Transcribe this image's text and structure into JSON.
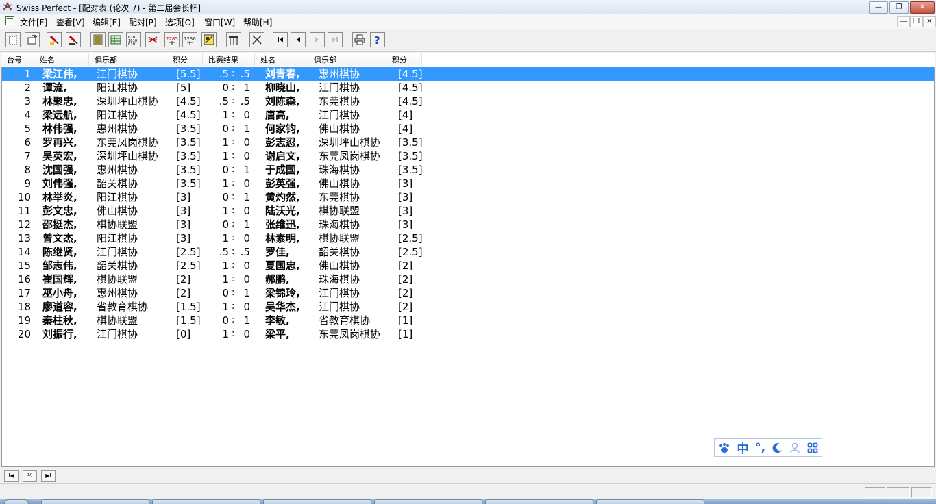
{
  "window": {
    "title": "Swiss Perfect - [配对表  (轮次 7) - 第二届会长杯]",
    "minimize_glyph": "—",
    "restore_glyph": "❐",
    "close_glyph": "✕"
  },
  "menu": {
    "items": [
      "文件[F]",
      "查看[V]",
      "编辑[E]",
      "配对[P]",
      "选项[O]",
      "窗口[W]",
      "帮助[H]"
    ],
    "mdi_minimize": "—",
    "mdi_restore": "❐",
    "mdi_close": "✕"
  },
  "toolbar": {
    "label_2285": "2285",
    "label_1236": "1236"
  },
  "table": {
    "headers": [
      "台号",
      "姓名",
      "俱乐部",
      "积分",
      "比赛结果",
      "姓名",
      "俱乐部",
      "积分"
    ],
    "colon": ":",
    "rows": [
      {
        "board": "1",
        "white": "梁江伟,",
        "club1": "江门棋协",
        "pts1": "[5.5]",
        "s1": ".5",
        "s2": ".5",
        "black": "刘青春,",
        "club2": "惠州棋协",
        "pts2": "[4.5]"
      },
      {
        "board": "2",
        "white": "谭流,",
        "club1": "阳江棋协",
        "pts1": "[5]",
        "s1": "0",
        "s2": "1",
        "black": "柳晓山,",
        "club2": "江门棋协",
        "pts2": "[4.5]"
      },
      {
        "board": "3",
        "white": "林聚忠,",
        "club1": "深圳坪山棋协",
        "pts1": "[4.5]",
        "s1": ".5",
        "s2": ".5",
        "black": "刘陈森,",
        "club2": "东莞棋协",
        "pts2": "[4.5]"
      },
      {
        "board": "4",
        "white": "梁远航,",
        "club1": "阳江棋协",
        "pts1": "[4.5]",
        "s1": "1",
        "s2": "0",
        "black": "唐高,",
        "club2": "江门棋协",
        "pts2": "[4]"
      },
      {
        "board": "5",
        "white": "林伟强,",
        "club1": "惠州棋协",
        "pts1": "[3.5]",
        "s1": "0",
        "s2": "1",
        "black": "何家钧,",
        "club2": "佛山棋协",
        "pts2": "[4]"
      },
      {
        "board": "6",
        "white": "罗再兴,",
        "club1": "东莞凤岗棋协",
        "pts1": "[3.5]",
        "s1": "1",
        "s2": "0",
        "black": "彭志忍,",
        "club2": "深圳坪山棋协",
        "pts2": "[3.5]"
      },
      {
        "board": "7",
        "white": "吴英宏,",
        "club1": "深圳坪山棋协",
        "pts1": "[3.5]",
        "s1": "1",
        "s2": "0",
        "black": "谢启文,",
        "club2": "东莞凤岗棋协",
        "pts2": "[3.5]"
      },
      {
        "board": "8",
        "white": "沈国强,",
        "club1": "惠州棋协",
        "pts1": "[3.5]",
        "s1": "0",
        "s2": "1",
        "black": "于成国,",
        "club2": "珠海棋协",
        "pts2": "[3.5]"
      },
      {
        "board": "9",
        "white": "刘伟强,",
        "club1": "韶关棋协",
        "pts1": "[3.5]",
        "s1": "1",
        "s2": "0",
        "black": "彭英强,",
        "club2": "佛山棋协",
        "pts2": "[3]"
      },
      {
        "board": "10",
        "white": "林举炎,",
        "club1": "阳江棋协",
        "pts1": "[3]",
        "s1": "0",
        "s2": "1",
        "black": "黄灼然,",
        "club2": "东莞棋协",
        "pts2": "[3]"
      },
      {
        "board": "11",
        "white": "彭文忠,",
        "club1": "佛山棋协",
        "pts1": "[3]",
        "s1": "1",
        "s2": "0",
        "black": "陆沃光,",
        "club2": "棋协联盟",
        "pts2": "[3]"
      },
      {
        "board": "12",
        "white": "邵挺杰,",
        "club1": "棋协联盟",
        "pts1": "[3]",
        "s1": "0",
        "s2": "1",
        "black": "张维迅,",
        "club2": "珠海棋协",
        "pts2": "[3]"
      },
      {
        "board": "13",
        "white": "曾文杰,",
        "club1": "阳江棋协",
        "pts1": "[3]",
        "s1": "1",
        "s2": "0",
        "black": "林素明,",
        "club2": "棋协联盟",
        "pts2": "[2.5]"
      },
      {
        "board": "14",
        "white": "陈继贤,",
        "club1": "江门棋协",
        "pts1": "[2.5]",
        "s1": ".5",
        "s2": ".5",
        "black": "罗佳,",
        "club2": "韶关棋协",
        "pts2": "[2.5]"
      },
      {
        "board": "15",
        "white": "邹志伟,",
        "club1": "韶关棋协",
        "pts1": "[2.5]",
        "s1": "1",
        "s2": "0",
        "black": "夏国忠,",
        "club2": "佛山棋协",
        "pts2": "[2]"
      },
      {
        "board": "16",
        "white": "崔国辉,",
        "club1": "棋协联盟",
        "pts1": "[2]",
        "s1": "1",
        "s2": "0",
        "black": "郝鹏,",
        "club2": "珠海棋协",
        "pts2": "[2]"
      },
      {
        "board": "17",
        "white": "巫小舟,",
        "club1": "惠州棋协",
        "pts1": "[2]",
        "s1": "0",
        "s2": "1",
        "black": "梁锦玲,",
        "club2": "江门棋协",
        "pts2": "[2]"
      },
      {
        "board": "18",
        "white": "廖道容,",
        "club1": "省教育棋协",
        "pts1": "[1.5]",
        "s1": "1",
        "s2": "0",
        "black": "吴华杰,",
        "club2": "江门棋协",
        "pts2": "[2]"
      },
      {
        "board": "19",
        "white": "秦柱秋,",
        "club1": "棋协联盟",
        "pts1": "[1.5]",
        "s1": "0",
        "s2": "1",
        "black": "李敏,",
        "club2": "省教育棋协",
        "pts2": "[1]"
      },
      {
        "board": "20",
        "white": "刘振行,",
        "club1": "江门棋协",
        "pts1": "[0]",
        "s1": "1",
        "s2": "0",
        "black": "梁平,",
        "club2": "东莞凤岗棋协",
        "pts2": "[1]"
      }
    ]
  },
  "ime": {
    "mode": "中",
    "punct": "°,"
  },
  "pagebar": {
    "first": "I◀",
    "half": "½",
    "last": "▶I"
  },
  "colors": {
    "selection": "#3399ff",
    "ime_accent": "#2a6ed6"
  }
}
